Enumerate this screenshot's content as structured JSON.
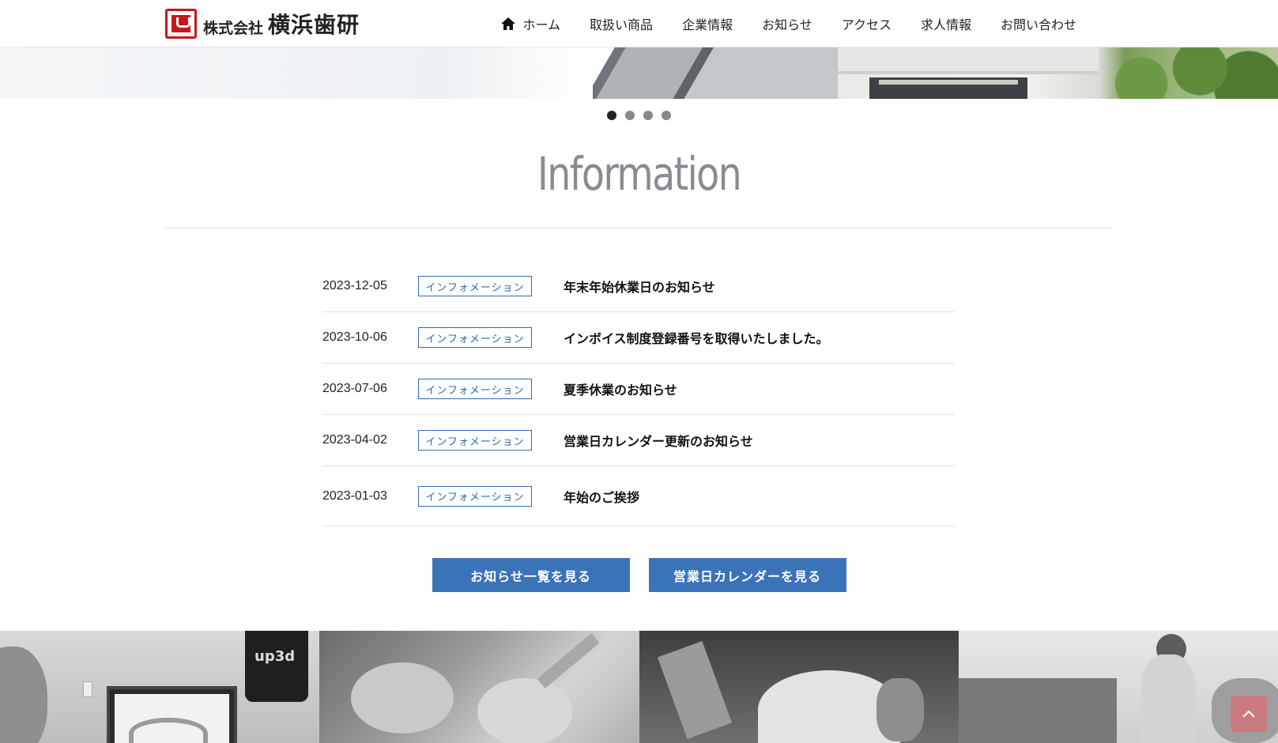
{
  "header": {
    "logo_small": "株式会社",
    "logo_big": "横浜歯研",
    "nav": [
      {
        "label": "ホーム",
        "icon": "home-icon"
      },
      {
        "label": "取扱い商品"
      },
      {
        "label": "企業情報"
      },
      {
        "label": "お知らせ"
      },
      {
        "label": "アクセス"
      },
      {
        "label": "求人情報"
      },
      {
        "label": "お問い合わせ"
      }
    ]
  },
  "slider": {
    "slide_count": 4,
    "active": 1
  },
  "information": {
    "title": "Information",
    "items": [
      {
        "date": "2023-12-05",
        "category": "インフォメーション",
        "title": "年末年始休業日のお知らせ"
      },
      {
        "date": "2023-10-06",
        "category": "インフォメーション",
        "title": "インボイス制度登録番号を取得いたしました。"
      },
      {
        "date": "2023-07-06",
        "category": "インフォメーション",
        "title": "夏季休業のお知らせ"
      },
      {
        "date": "2023-04-02",
        "category": "インフォメーション",
        "title": "営業日カレンダー更新のお知らせ"
      },
      {
        "date": "2023-01-03",
        "category": "インフォメーション",
        "title": "年始のご挨拶"
      }
    ],
    "buttons": {
      "news_list": "お知らせ一覧を見る",
      "calendar": "営業日カレンダーを見る"
    }
  },
  "photos": {
    "band_text": "up3d"
  },
  "colors": {
    "brand_red": "#c8161d",
    "accent_blue": "#3b73b9",
    "category_blue": "#2e6bb0",
    "title_gray": "#8a8a92"
  }
}
